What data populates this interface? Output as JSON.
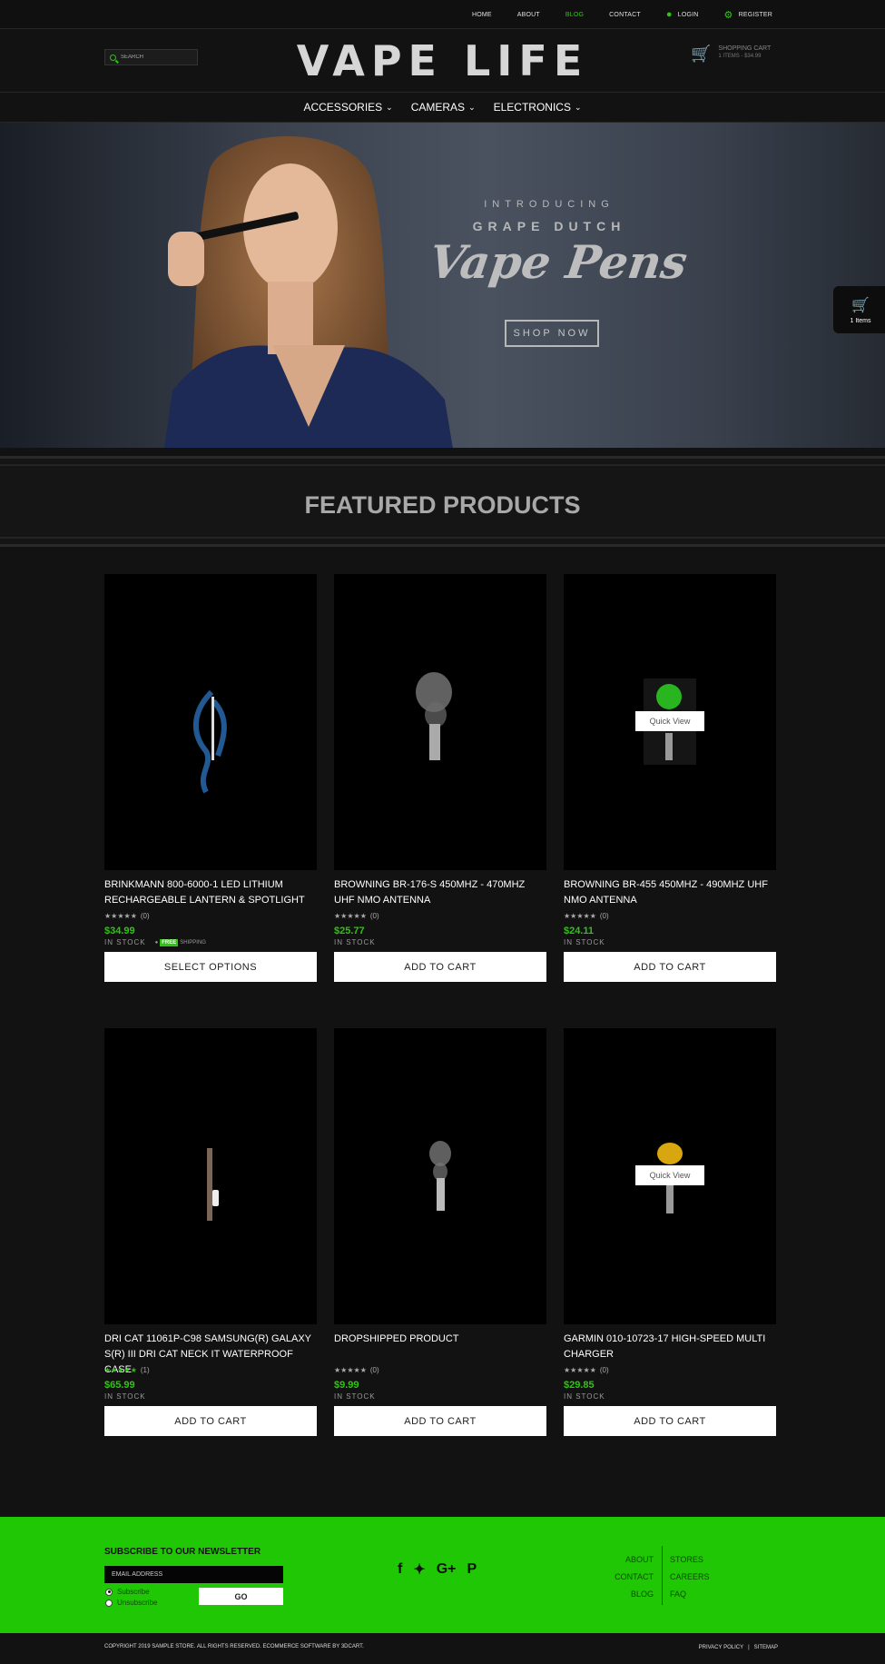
{
  "topnav": {
    "home": "HOME",
    "about": "ABOUT",
    "blog": "BLOG",
    "contact": "CONTACT",
    "login": "LOGIN",
    "register": "REGISTER"
  },
  "header": {
    "search_placeholder": "SEARCH",
    "logo": "VAPE LIFE",
    "cart_title": "SHOPPING CART",
    "cart_summary": "1 ITEMS - $34.99"
  },
  "categories": {
    "accessories": "ACCESSORIES",
    "cameras": "CAMERAS",
    "electronics": "ELECTRONICS"
  },
  "hero": {
    "line1": "INTRODUCING",
    "line2": "GRAPE DUTCH",
    "headline": "Vape Pens",
    "cta": "SHOP NOW"
  },
  "side_cart": {
    "label": "1 Items"
  },
  "featured": {
    "title": "FEATURED PRODUCTS"
  },
  "quick_view_label": "Quick View",
  "products": [
    {
      "name": "BRINKMANN 800-6000-1 LED LITHIUM RECHARGEABLE LANTERN & SPOTLIGHT",
      "reviews": "(0)",
      "price": "$34.99",
      "stock": "IN STOCK",
      "free_badge": "FREE",
      "free_text": "SHIPPING",
      "button": "SELECT OPTIONS",
      "rating": 0
    },
    {
      "name": "BROWNING BR-176-S 450MHZ - 470MHZ UHF NMO ANTENNA",
      "reviews": "(0)",
      "price": "$25.77",
      "stock": "IN STOCK",
      "button": "ADD TO CART",
      "rating": 0
    },
    {
      "name": "BROWNING BR-455 450MHZ - 490MHZ UHF NMO ANTENNA",
      "reviews": "(0)",
      "price": "$24.11",
      "stock": "IN STOCK",
      "button": "ADD TO CART",
      "rating": 0
    },
    {
      "name": "DRI CAT 11061P-C98 SAMSUNG(R) GALAXY S(R) III DRI CAT NECK IT WATERPROOF CASE",
      "reviews": "(1)",
      "price": "$65.99",
      "stock": "IN STOCK",
      "button": "ADD TO CART",
      "rating": 5
    },
    {
      "name": "DROPSHIPPED PRODUCT",
      "reviews": "(0)",
      "price": "$9.99",
      "stock": "IN STOCK",
      "button": "ADD TO CART",
      "rating": 0
    },
    {
      "name": "GARMIN 010-10723-17 HIGH-SPEED MULTI CHARGER",
      "reviews": "(0)",
      "price": "$29.85",
      "stock": "IN STOCK",
      "button": "ADD TO CART",
      "rating": 0
    }
  ],
  "footer": {
    "newsletter_title": "SUBSCRIBE TO OUR NEWSLETTER",
    "email_placeholder": "EMAIL ADDRESS",
    "subscribe": "Subscribe",
    "unsubscribe": "Unsubscribe",
    "go": "GO",
    "links_left": [
      "ABOUT",
      "CONTACT",
      "BLOG"
    ],
    "links_right": [
      "STORES",
      "CAREERS",
      "FAQ"
    ]
  },
  "bottom": {
    "copyright": "COPYRIGHT 2019 SAMPLE STORE. ALL RIGHTS RESERVED. ECOMMERCE SOFTWARE BY 3DCART.",
    "privacy": "PRIVACY POLICY",
    "separator": "|",
    "sitemap": "SITEMAP"
  },
  "colors": {
    "accent": "#2ec411",
    "footer_bg": "#1fc704",
    "page_bg": "#121212"
  }
}
